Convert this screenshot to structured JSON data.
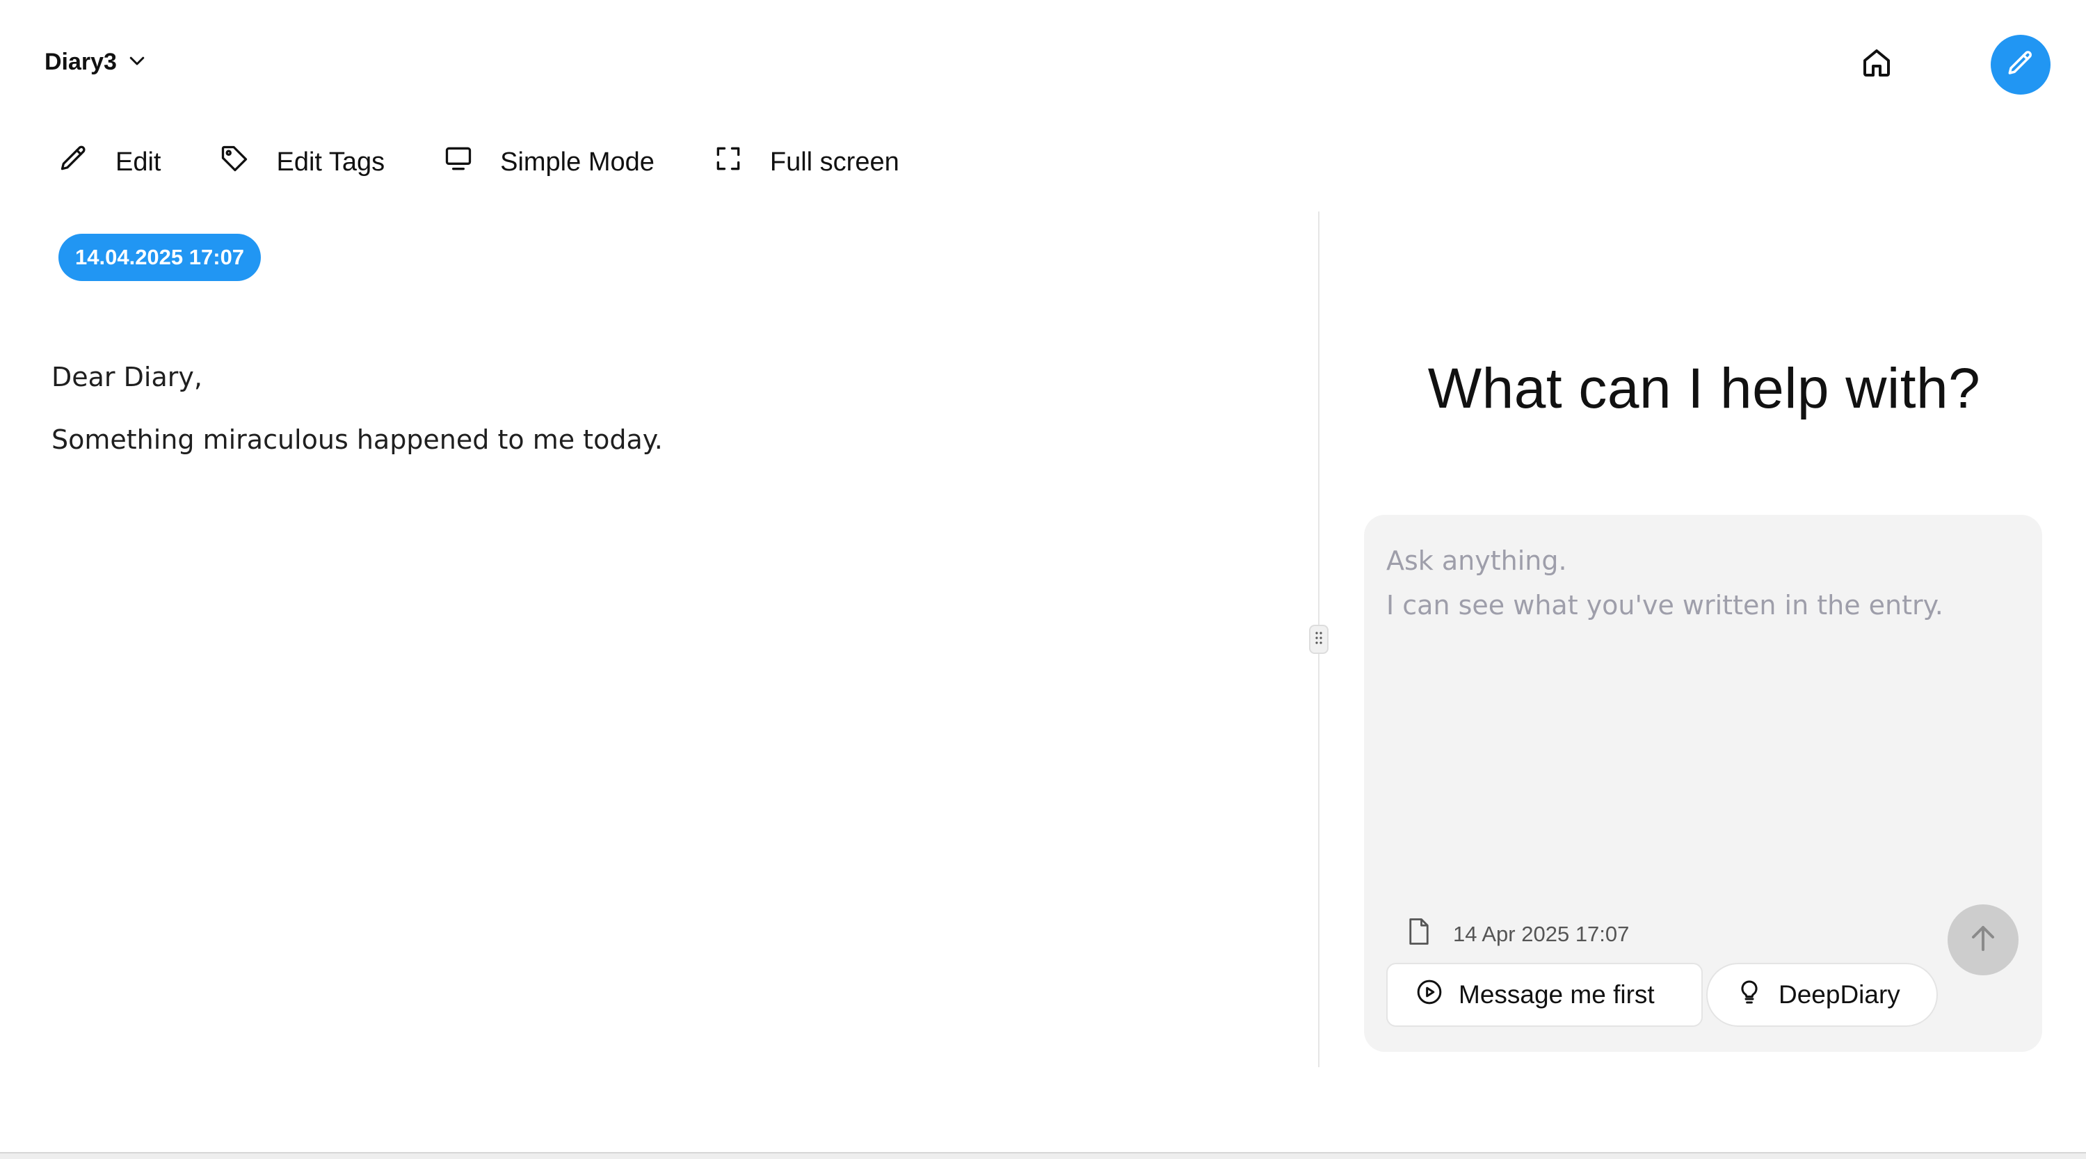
{
  "header": {
    "diary_name": "Diary3",
    "diary_switch_icon": "chevron-down-icon",
    "home_icon": "home-icon",
    "new_entry_icon": "pencil-icon"
  },
  "toolbar": {
    "edit_label": "Edit",
    "edit_tags_label": "Edit Tags",
    "simple_mode_label": "Simple Mode",
    "full_screen_label": "Full screen"
  },
  "entry": {
    "date_badge": "14.04.2025 17:07",
    "paragraphs": [
      "Dear Diary,",
      "Something miraculous happened to me today."
    ]
  },
  "assistant": {
    "heading": "What can I help with?",
    "input_placeholder": "Ask anything.\nI can see what you've written in the entry.",
    "input_value": "",
    "entry_reference": "14 Apr 2025 17:07",
    "message_first_label": "Message me first",
    "deep_diary_label": "DeepDiary",
    "send_icon": "arrow-up-icon"
  },
  "colors": {
    "accent": "#2196f3",
    "chat_bg": "#f3f3f3",
    "send_disabled": "#cdcdcd",
    "placeholder": "#9e9eaa"
  }
}
